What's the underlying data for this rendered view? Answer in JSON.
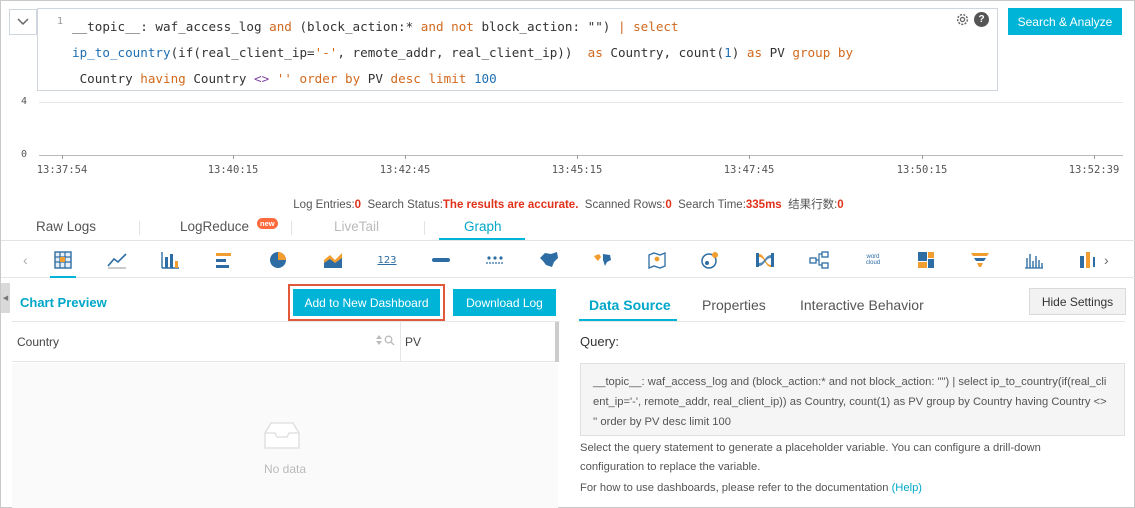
{
  "editor": {
    "line_number": "1",
    "lines": [
      [
        {
          "t": "__topic__: waf_access_log ",
          "c": ""
        },
        {
          "t": "and",
          "c": "kw"
        },
        {
          "t": " (block_action:* ",
          "c": ""
        },
        {
          "t": "and not",
          "c": "kw"
        },
        {
          "t": " block_action: \"\") ",
          "c": ""
        },
        {
          "t": "| select",
          "c": "kw"
        }
      ],
      [
        {
          "t": "ip_to_country",
          "c": "fn"
        },
        {
          "t": "(if(real_client_ip=",
          "c": ""
        },
        {
          "t": "'-'",
          "c": "str"
        },
        {
          "t": ", remote_addr, real_client_ip))  ",
          "c": ""
        },
        {
          "t": "as",
          "c": "kw"
        },
        {
          "t": " Country, count(",
          "c": ""
        },
        {
          "t": "1",
          "c": "num"
        },
        {
          "t": ") ",
          "c": ""
        },
        {
          "t": "as",
          "c": "kw"
        },
        {
          "t": " PV ",
          "c": ""
        },
        {
          "t": "group by",
          "c": "kw"
        }
      ],
      [
        {
          "t": " Country ",
          "c": ""
        },
        {
          "t": "having",
          "c": "kw"
        },
        {
          "t": " Country ",
          "c": ""
        },
        {
          "t": "<>",
          "c": "op"
        },
        {
          "t": " '' ",
          "c": "str"
        },
        {
          "t": "order by",
          "c": "kw"
        },
        {
          "t": " PV ",
          "c": ""
        },
        {
          "t": "desc limit",
          "c": "kw"
        },
        {
          "t": " ",
          "c": ""
        },
        {
          "t": "100",
          "c": "num"
        }
      ]
    ],
    "search_button": "Search & Analyze",
    "icons": [
      "collapse-chevron-icon",
      "gear-icon",
      "help-icon"
    ]
  },
  "histogram": {
    "y_ticks": [
      "4",
      "0"
    ],
    "x_ticks": [
      "13:37:54",
      "13:40:15",
      "13:42:45",
      "13:45:15",
      "13:47:45",
      "13:50:15",
      "13:52:39"
    ]
  },
  "status": {
    "log_entries_label": "Log Entries:",
    "log_entries_value": "0",
    "search_status_label": "Search Status:",
    "search_status_value": "The results are accurate.",
    "scanned_rows_label": "Scanned Rows:",
    "scanned_rows_value": "0",
    "search_time_label": "Search Time:",
    "search_time_value": "335ms",
    "result_rows_label": "结果行数:",
    "result_rows_value": "0"
  },
  "tabs": {
    "raw_logs": "Raw Logs",
    "logreduce": "LogReduce",
    "new_badge": "new",
    "livetail": "LiveTail",
    "graph": "Graph"
  },
  "chart_types": [
    "table-chart-icon",
    "line-chart-icon",
    "bar-chart-icon",
    "horizontal-bar-chart-icon",
    "pie-chart-icon",
    "area-chart-icon",
    "single-value-icon",
    "progress-bar-icon",
    "map-icon",
    "china-map-icon",
    "world-map-icon",
    "amap-icon",
    "flow-chart-icon",
    "sankey-icon",
    "tree-icon",
    "word-cloud-icon",
    "treemap-icon",
    "funnel-icon",
    "histogram-icon",
    "bar-plus-icon"
  ],
  "single_value_glyph": "123",
  "word_cloud_glyph": "word cloud",
  "preview": {
    "title": "Chart Preview",
    "add_dashboard": "Add to New Dashboard",
    "download_log": "Download Log",
    "columns": [
      "Country",
      "PV"
    ],
    "no_data": "No data"
  },
  "settings": {
    "tabs": [
      "Data Source",
      "Properties",
      "Interactive Behavior"
    ],
    "hide_settings": "Hide Settings",
    "query_label": "Query:",
    "query_text": "__topic__: waf_access_log and (block_action:* and not block_action: \"\") | select ip_to_country(if(real_client_ip='-', remote_addr, real_client_ip)) as Country, count(1) as PV group by Country having Country <> '' order by PV desc limit 100",
    "note1": "Select the query statement to generate a placeholder variable. You can configure a drill-down",
    "note2": "configuration to replace the variable.",
    "note3": "For how to use dashboards, please refer to the documentation",
    "help_link": "(Help)"
  },
  "colors": {
    "accent": "#00b4d8",
    "status_red": "#e0311a",
    "highlight_border": "#e2583a"
  }
}
